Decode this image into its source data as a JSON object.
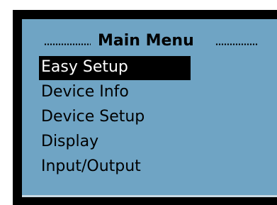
{
  "menu": {
    "title": "Main Menu",
    "items": [
      {
        "label": "Easy Setup",
        "selected": true
      },
      {
        "label": "Device Info",
        "selected": false
      },
      {
        "label": "Device Setup",
        "selected": false
      },
      {
        "label": "Display",
        "selected": false
      },
      {
        "label": "Input/Output",
        "selected": false
      }
    ]
  },
  "colors": {
    "screen_bg": "#6fa4c4",
    "frame": "#000000",
    "highlight_bg": "#000000",
    "highlight_text": "#ffffff"
  }
}
